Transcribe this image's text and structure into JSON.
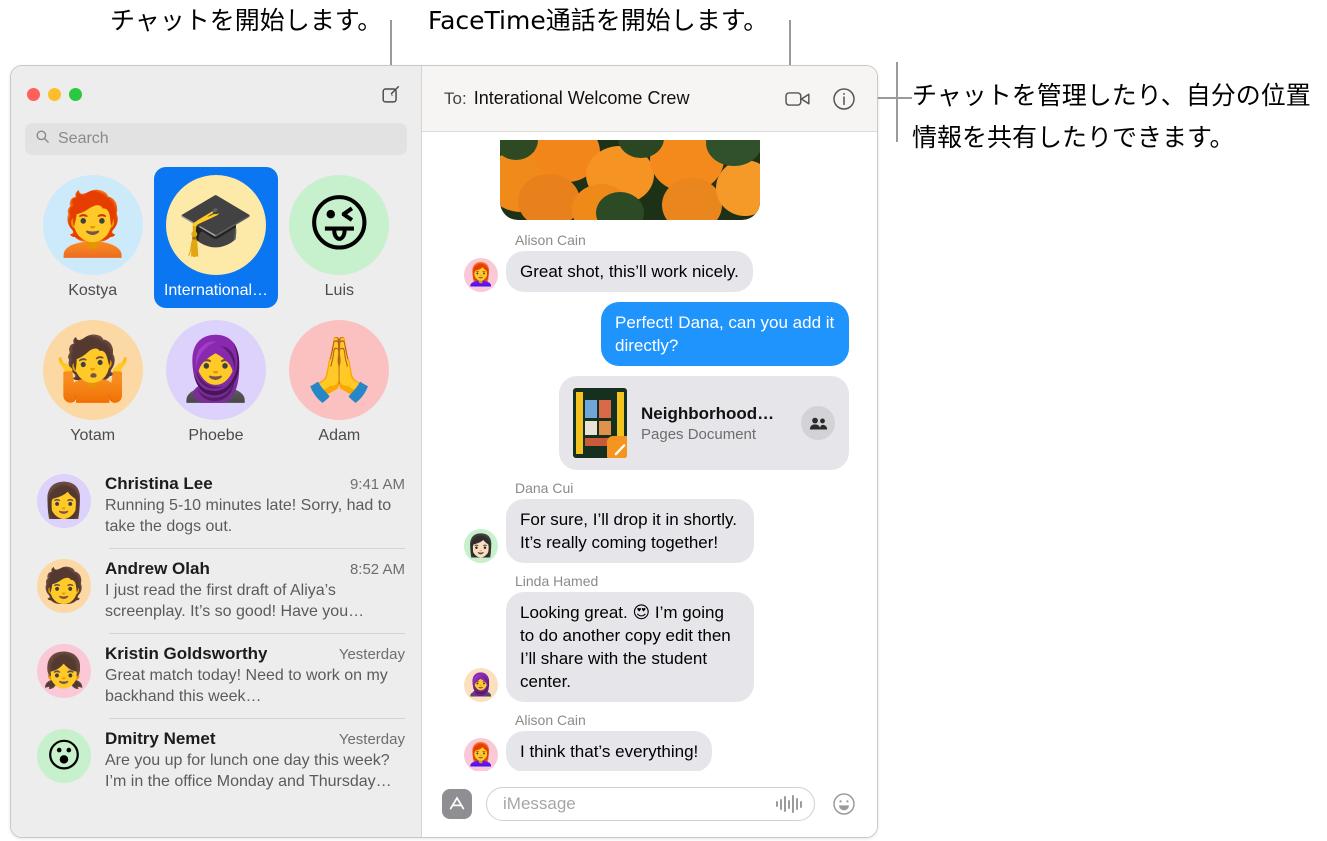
{
  "callouts": [
    {
      "id": "compose",
      "text": "チャットを開始します。"
    },
    {
      "id": "facetime",
      "text": "FaceTime通話を開始します。"
    },
    {
      "id": "details",
      "text": "チャットを管理したり、自分の位置\n情報を共有したりできます。"
    }
  ],
  "window": {
    "traffic_lights": [
      "close",
      "minimize",
      "zoom"
    ]
  },
  "sidebar": {
    "compose_label": "compose-message",
    "search": {
      "placeholder": "Search",
      "value": ""
    },
    "pinned": [
      {
        "name": "Kostya",
        "glyph": "🧑‍🦰",
        "bg": "#cdeafb",
        "selected": false
      },
      {
        "name": "International…",
        "glyph": "🎓",
        "bg": "#fde9a8",
        "selected": true
      },
      {
        "name": "Luis",
        "glyph": "😜",
        "bg": "#c7f0cd",
        "selected": false
      },
      {
        "name": "Yotam",
        "glyph": "🤷",
        "bg": "#fcd9a4",
        "selected": false
      },
      {
        "name": "Phoebe",
        "glyph": "🧕",
        "bg": "#ddd2fb",
        "selected": false
      },
      {
        "name": "Adam",
        "glyph": "🙏",
        "bg": "#fbc0c0",
        "selected": false
      }
    ],
    "conversations": [
      {
        "name": "Christina Lee",
        "time": "9:41 AM",
        "preview": "Running 5-10 minutes late! Sorry, had to take the dogs out.",
        "glyph": "👩",
        "bg": "#ddd2fb"
      },
      {
        "name": "Andrew Olah",
        "time": "8:52 AM",
        "preview": "I just read the first draft of Aliya’s screenplay. It’s so good! Have you…",
        "glyph": "🧑",
        "bg": "#fcd9a4"
      },
      {
        "name": "Kristin Goldsworthy",
        "time": "Yesterday",
        "preview": "Great match today! Need to work on my backhand this week…",
        "glyph": "👧",
        "bg": "#fbc8d8"
      },
      {
        "name": "Dmitry Nemet",
        "time": "Yesterday",
        "preview": "Are you up for lunch one day this week? I’m in the office Monday and Thursday…",
        "glyph": "😮",
        "bg": "#c7f0cd"
      }
    ]
  },
  "chat": {
    "header": {
      "to_label": "To:",
      "recipient": "Interational Welcome Crew",
      "facetime_label": "facetime-video-call",
      "info_label": "conversation-details"
    },
    "photo_message": {
      "alt": "orange flowers photo"
    },
    "messages": [
      {
        "sender": "Alison Cain",
        "text": "Great shot, this’ll work nicely.",
        "direction": "in",
        "glyph": "👩‍🦰",
        "bg": "#fbc8d8"
      },
      {
        "sender": "",
        "text": "Perfect! Dana, can you add it directly?",
        "direction": "out"
      },
      {
        "sender": "",
        "direction": "out",
        "attachment": {
          "title": "Neighborhood…",
          "subtitle": "Pages Document",
          "shared_icon": "people-icon"
        }
      },
      {
        "sender": "Dana Cui",
        "text": "For sure, I’ll drop it in shortly. It’s really coming together!",
        "direction": "in",
        "glyph": "👩🏻",
        "bg": "#c7f0cd"
      },
      {
        "sender": "Linda Hamed",
        "text": "Looking great. 😍 I’m going to do another copy edit then I’ll share with the student center.",
        "direction": "in",
        "glyph": "🧕",
        "bg": "#fbe0c0"
      },
      {
        "sender": "Alison Cain",
        "text": "I think that’s everything!",
        "direction": "in",
        "glyph": "👩‍🦰",
        "bg": "#fbc8d8"
      }
    ],
    "input": {
      "apps_label": "app-store-apps",
      "placeholder": "iMessage",
      "value": "",
      "audio_label": "audio-message",
      "emoji_label": "emoji-picker"
    }
  },
  "colors": {
    "accent_blue": "#0a76f2",
    "bubble_out": "#1f94fc",
    "bubble_in": "#e6e5ea",
    "sidebar_bg": "#ededed",
    "header_bg": "#f7f5f3"
  }
}
